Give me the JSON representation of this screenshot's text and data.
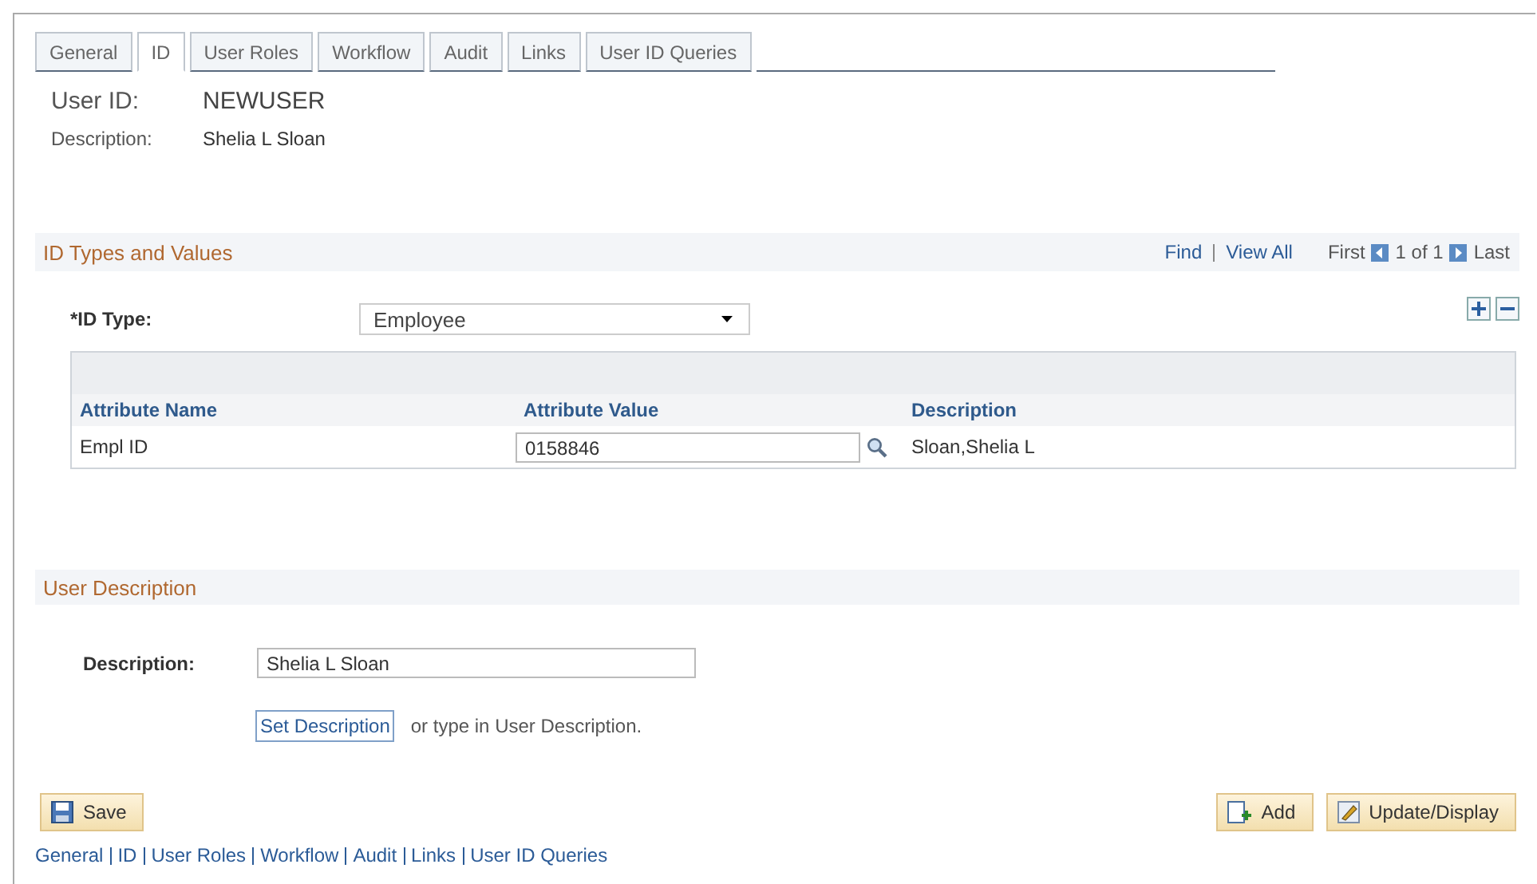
{
  "tabs": [
    {
      "label": "General",
      "selected": false
    },
    {
      "label": "ID",
      "selected": true
    },
    {
      "label": "User Roles",
      "selected": false
    },
    {
      "label": "Workflow",
      "selected": false
    },
    {
      "label": "Audit",
      "selected": false
    },
    {
      "label": "Links",
      "selected": false
    },
    {
      "label": "User ID Queries",
      "selected": false
    }
  ],
  "header": {
    "user_id_label": "User ID:",
    "user_id": "NEWUSER",
    "description_label": "Description:",
    "description": "Shelia L Sloan"
  },
  "id_section": {
    "title": "ID Types and Values",
    "find": "Find",
    "view_all": "View All",
    "first": "First",
    "range": "1 of 1",
    "last": "Last",
    "id_type_label": "*ID Type:",
    "id_type": "Employee",
    "columns": [
      "Attribute Name",
      "Attribute Value",
      "Description"
    ],
    "rows": [
      {
        "name": "Empl ID",
        "value": "0158846",
        "description": "Sloan,Shelia L"
      }
    ]
  },
  "user_description": {
    "title": "User Description",
    "label": "Description:",
    "value": "Shelia L Sloan",
    "set_button": "Set Description",
    "hint": "or type in User Description."
  },
  "buttons": {
    "save": "Save",
    "add": "Add",
    "update": "Update/Display"
  },
  "footer_links": [
    "General",
    "ID",
    "User Roles",
    "Workflow",
    "Audit",
    "Links",
    "User ID Queries"
  ]
}
